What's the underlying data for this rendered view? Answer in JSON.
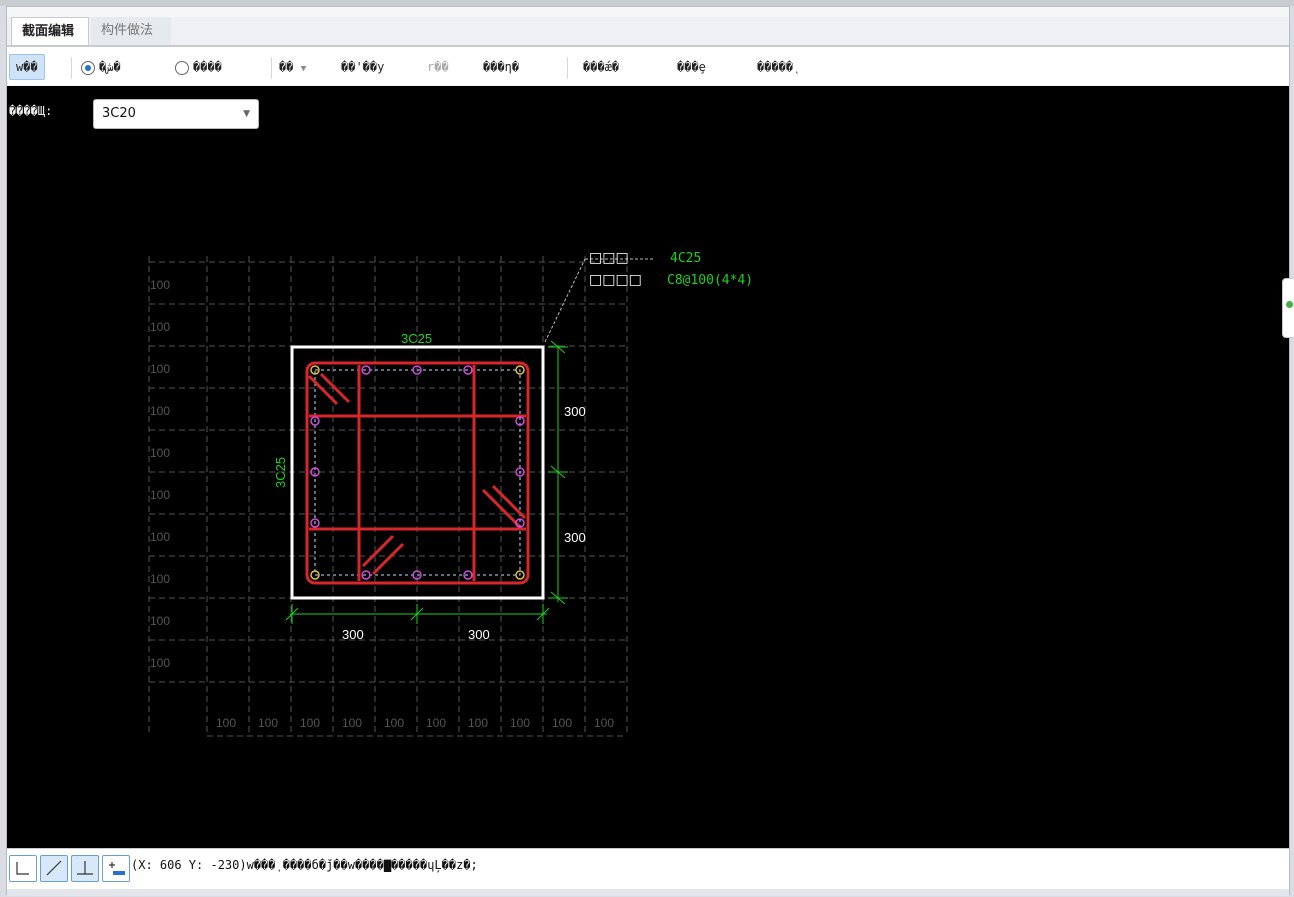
{
  "tabs": [
    {
      "label": "截面编辑",
      "active": true
    },
    {
      "label": "构件做法",
      "active": false
    }
  ],
  "toolbar": {
    "btn1": "w��",
    "radio1": "�ش�",
    "radio2": "����",
    "btn2": "��",
    "btn3": "��'��y",
    "btn4": "r��",
    "btn5": "���η�",
    "btn6": "���ǽ�",
    "btn7": "���ȩ",
    "btn8": "�����ͺ"
  },
  "rebar_select": {
    "label": "����Щ:",
    "value": "3C20"
  },
  "drawing": {
    "grid_labels": [
      "100",
      "100",
      "100",
      "100",
      "100",
      "100",
      "100",
      "100",
      "100",
      "100"
    ],
    "top_rebar": "3C25",
    "side_rebar": "3C25",
    "dim_right": [
      "300",
      "300"
    ],
    "dim_bottom": [
      "300",
      "300"
    ],
    "leader_label_1": "□□□",
    "leader_label_2": "□□□□",
    "leader_value_1": "4C25",
    "leader_value_2": "C8@100(4*4)"
  },
  "status": {
    "coord_text": "(X: 606 Y: -230)w���ͺ����б�ǰ��w����▇�����ɥĻ��z�;"
  },
  "colors": {
    "rebar": "#d8262b",
    "dim": "#1fd21f",
    "section": "#ffffff",
    "grid": "#555555"
  }
}
